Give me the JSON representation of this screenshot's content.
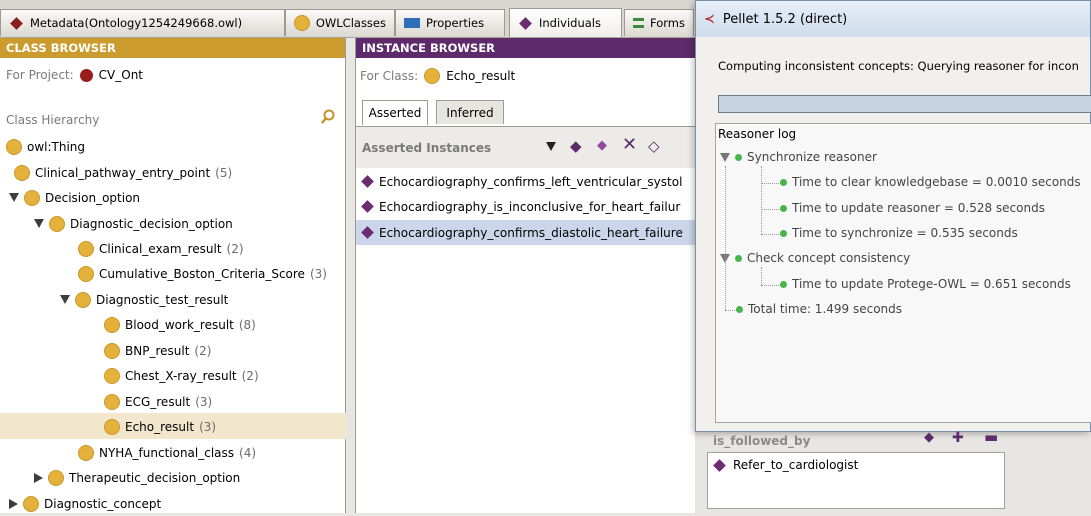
{
  "tabs": [
    {
      "label": "Metadata(Ontology1254249668.owl)",
      "icon": "metadata-icon"
    },
    {
      "label": "OWLClasses",
      "icon": "owl-classes-icon"
    },
    {
      "label": "Properties",
      "icon": "properties-icon"
    },
    {
      "label": "Individuals",
      "icon": "individuals-icon"
    },
    {
      "label": "Forms",
      "icon": "forms-icon"
    }
  ],
  "class_browser": {
    "header": "CLASS BROWSER",
    "project_label": "For Project:",
    "project_name": "CV_Ont",
    "hierarchy_label": "Class Hierarchy",
    "tree": [
      {
        "label": "owl:Thing",
        "count": ""
      },
      {
        "label": "Clinical_pathway_entry_point",
        "count": "(5)"
      },
      {
        "label": "Decision_option",
        "count": ""
      },
      {
        "label": "Diagnostic_decision_option",
        "count": ""
      },
      {
        "label": "Clinical_exam_result",
        "count": "(2)"
      },
      {
        "label": "Cumulative_Boston_Criteria_Score",
        "count": "(3)"
      },
      {
        "label": "Diagnostic_test_result",
        "count": ""
      },
      {
        "label": "Blood_work_result",
        "count": "(8)"
      },
      {
        "label": "BNP_result",
        "count": "(2)"
      },
      {
        "label": "Chest_X-ray_result",
        "count": "(2)"
      },
      {
        "label": "ECG_result",
        "count": "(3)"
      },
      {
        "label": "Echo_result",
        "count": "(3)"
      },
      {
        "label": "NYHA_functional_class",
        "count": "(4)"
      },
      {
        "label": "Therapeutic_decision_option",
        "count": ""
      },
      {
        "label": "Diagnostic_concept",
        "count": ""
      }
    ]
  },
  "instance_browser": {
    "header": "INSTANCE BROWSER",
    "class_label": "For Class:",
    "class_name": "Echo_result",
    "tab_asserted": "Asserted",
    "tab_inferred": "Inferred",
    "list_label": "Asserted Instances",
    "items": [
      "Echocardiography_confirms_left_ventricular_systol",
      "Echocardiography_is_inconclusive_for_heart_failur",
      "Echocardiography_confirms_diastolic_heart_failure"
    ]
  },
  "pellet": {
    "title": "Pellet 1.5.2 (direct)",
    "status": "Computing inconsistent concepts: Querying reasoner for incon",
    "log_title": "Reasoner log",
    "log": {
      "sync": "Synchronize reasoner",
      "clear": "Time to clear knowledgebase = 0.0010 seconds",
      "update": "Time to update reasoner = 0.528 seconds",
      "synchronize": "Time to synchronize = 0.535 seconds",
      "check": "Check concept consistency",
      "protege": "Time to update Protege-OWL = 0.651 seconds",
      "total": "Total time: 1.499 seconds"
    }
  },
  "lower": {
    "prop_label": "is_followed_by",
    "value": "Refer_to_cardiologist"
  },
  "colors": {
    "class_header": "#cc9b2e",
    "instance_header": "#5e2a6b",
    "selection": "#cbd6ea"
  }
}
